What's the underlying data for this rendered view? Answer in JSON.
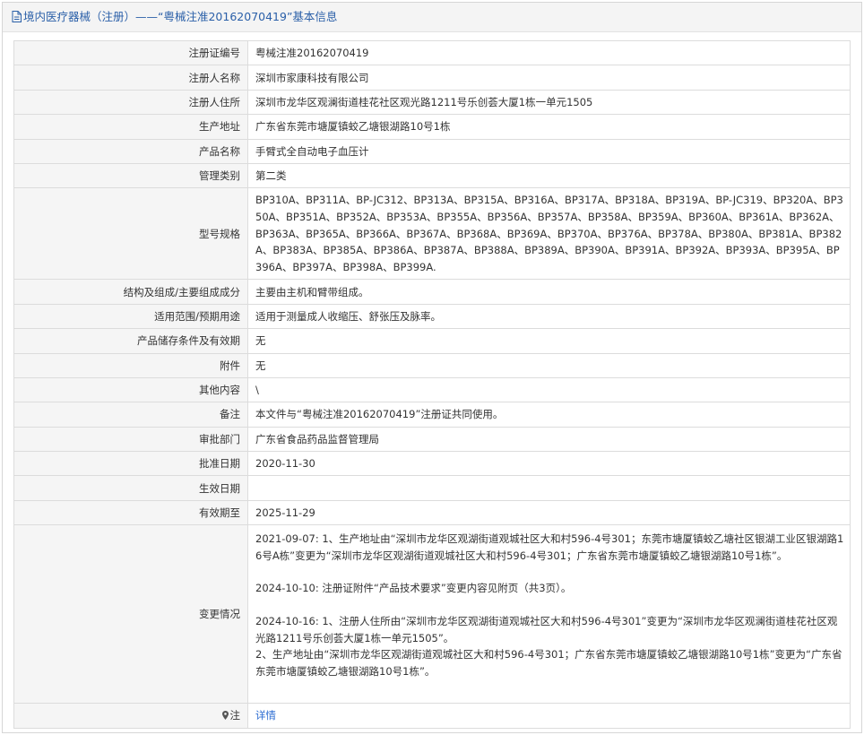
{
  "header": {
    "title": "境内医疗器械（注册）——“粤械注准20162070419”基本信息"
  },
  "rows": [
    {
      "label": "注册证编号",
      "value": "粤械注准20162070419"
    },
    {
      "label": "注册人名称",
      "value": "深圳市家康科技有限公司"
    },
    {
      "label": "注册人住所",
      "value": "深圳市龙华区观澜街道桂花社区观光路1211号乐创荟大厦1栋一单元1505"
    },
    {
      "label": "生产地址",
      "value": "广东省东莞市塘厦镇蛟乙塘银湖路10号1栋"
    },
    {
      "label": "产品名称",
      "value": "手臂式全自动电子血压计"
    },
    {
      "label": "管理类别",
      "value": "第二类"
    },
    {
      "label": "型号规格",
      "value": "BP310A、BP311A、BP-JC312、BP313A、BP315A、BP316A、BP317A、BP318A、BP319A、BP-JC319、BP320A、BP350A、BP351A、BP352A、BP353A、BP355A、BP356A、BP357A、BP358A、BP359A、BP360A、BP361A、BP362A、BP363A、BP365A、BP366A、BP367A、BP368A、BP369A、BP370A、BP376A、BP378A、BP380A、BP381A、BP382A、BP383A、BP385A、BP386A、BP387A、BP388A、BP389A、BP390A、BP391A、BP392A、BP393A、BP395A、BP396A、BP397A、BP398A、BP399A."
    },
    {
      "label": "结构及组成/主要组成成分",
      "value": "主要由主机和臂带组成。"
    },
    {
      "label": "适用范围/预期用途",
      "value": "适用于测量成人收缩压、舒张压及脉率。"
    },
    {
      "label": "产品储存条件及有效期",
      "value": "无"
    },
    {
      "label": "附件",
      "value": "无"
    },
    {
      "label": "其他内容",
      "value": "\\"
    },
    {
      "label": "备注",
      "value": "本文件与“粤械注准20162070419”注册证共同使用。"
    },
    {
      "label": "审批部门",
      "value": "广东省食品药品监督管理局"
    },
    {
      "label": "批准日期",
      "value": "2020-11-30"
    },
    {
      "label": "生效日期",
      "value": ""
    },
    {
      "label": "有效期至",
      "value": "2025-11-29"
    }
  ],
  "changes": {
    "label": "变更情况",
    "entry1": "2021-09-07: 1、生产地址由“深圳市龙华区观湖街道观城社区大和村596-4号301；东莞市塘厦镇蛟乙塘社区银湖工业区银湖路16号A栋”变更为“深圳市龙华区观湖街道观城社区大和村596-4号301；广东省东莞市塘厦镇蛟乙塘银湖路10号1栋”。",
    "entry2": "2024-10-10: 注册证附件“产品技术要求”变更内容见附页（共3页）。",
    "entry3a": "2024-10-16: 1、注册人住所由“深圳市龙华区观湖街道观城社区大和村596-4号301”变更为“深圳市龙华区观澜街道桂花社区观光路1211号乐创荟大厦1栋一单元1505”。",
    "entry3b": "2、生产地址由“深圳市龙华区观湖街道观城社区大和村596-4号301；广东省东莞市塘厦镇蛟乙塘银湖路10号1栋”变更为“广东省东莞市塘厦镇蛟乙塘银湖路10号1栋”。"
  },
  "note": {
    "label": "注",
    "link": "详情",
    "icon": "location-pin-icon"
  },
  "colors": {
    "title": "#2a5fa8",
    "link": "#2a6bd1",
    "label_bg": "#f5f5f5",
    "border": "#dcdcdc"
  }
}
